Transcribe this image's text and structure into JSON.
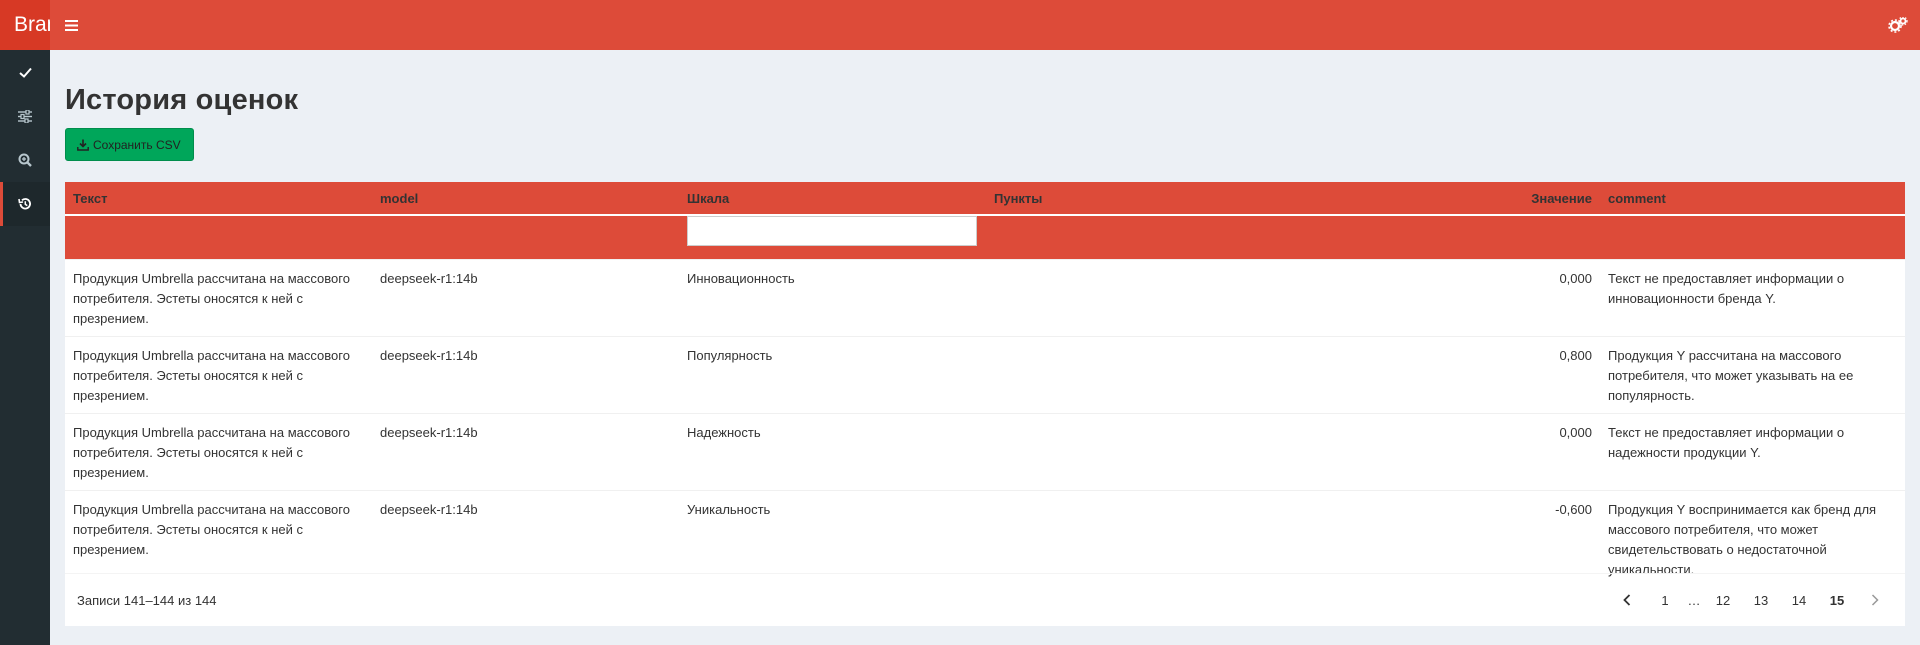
{
  "header": {
    "brand": "Brand",
    "menu_icon": "hamburger-icon",
    "settings_icon": "gears-icon"
  },
  "sidebar": {
    "items": [
      {
        "icon": "check-icon"
      },
      {
        "icon": "sliders-icon"
      },
      {
        "icon": "search-plus-icon"
      },
      {
        "icon": "history-icon",
        "active": true
      }
    ]
  },
  "page": {
    "title": "История оценок",
    "csv_button": "Сохранить CSV"
  },
  "table": {
    "columns": [
      "Текст",
      "model",
      "Шкала",
      "Пункты",
      "Значение",
      "comment"
    ],
    "filter_value": "",
    "rows": [
      {
        "text": "Продукция Umbrella рассчитана на массового потребителя. Эстеты оносятся к ней с презрением.",
        "model": "deepseek-r1:14b",
        "scale": "Инновационность",
        "points": "",
        "value": "0,000",
        "comment": "Текст не предоставляет информации о инновационности бренда Y."
      },
      {
        "text": "Продукция Umbrella рассчитана на массового потребителя. Эстеты оносятся к ней с презрением.",
        "model": "deepseek-r1:14b",
        "scale": "Популярность",
        "points": "",
        "value": "0,800",
        "comment": "Продукция Y рассчитана на массового потребителя, что может указывать на ее популярность."
      },
      {
        "text": "Продукция Umbrella рассчитана на массового потребителя. Эстеты оносятся к ней с презрением.",
        "model": "deepseek-r1:14b",
        "scale": "Надежность",
        "points": "",
        "value": "0,000",
        "comment": "Текст не предоставляет информации о надежности продукции Y."
      },
      {
        "text": "Продукция Umbrella рассчитана на массового потребителя. Эстеты оносятся к ней с презрением.",
        "model": "deepseek-r1:14b",
        "scale": "Уникальность",
        "points": "",
        "value": "-0,600",
        "comment": "Продукция Y воспринимается как бренд для массового потребителя, что может свидетельствовать о недостаточной уникальности."
      }
    ]
  },
  "pagination": {
    "info": "Записи 141–144 из 144",
    "pages": [
      "1",
      "…",
      "12",
      "13",
      "14",
      "15"
    ],
    "current": "15"
  },
  "colors": {
    "header": "#dd4b39",
    "sidebar": "#222d32",
    "button": "#00a65a",
    "background": "#ecf0f5"
  }
}
